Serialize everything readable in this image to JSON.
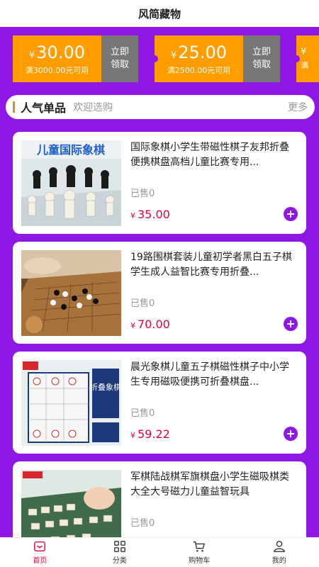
{
  "header": {
    "title": "风简藏物"
  },
  "coupons": [
    {
      "currency": "¥",
      "amount": "30.00",
      "condition": "满3000.00元可用",
      "action_line1": "立即",
      "action_line2": "领取"
    },
    {
      "currency": "¥",
      "amount": "25.00",
      "condition": "满2500.00元可用",
      "action_line1": "立即",
      "action_line2": "领取"
    },
    {
      "currency": "¥",
      "amount": "",
      "condition": "满",
      "action_line1": "",
      "action_line2": ""
    }
  ],
  "section": {
    "title": "人气单品",
    "subtitle": "欢迎选购",
    "more": "更多"
  },
  "products": [
    {
      "name": "国际象棋小学生带磁性棋子友邦折叠便携棋盘高档儿童比赛专用...",
      "sold": "已售0",
      "currency": "¥",
      "price": "35.00",
      "image_text": "儿童国际象棋"
    },
    {
      "name": "19路围棋套装儿童初学者黑白五子棋学生成人益智比赛专用折叠...",
      "sold": "已售0",
      "currency": "¥",
      "price": "70.00"
    },
    {
      "name": "晨光象棋儿童五子棋磁性棋子中小学生专用磁吸便携可折叠棋盘...",
      "sold": "已售0",
      "currency": "¥",
      "price": "59.22",
      "image_text": "折叠象棋"
    },
    {
      "name": "军棋陆战棋军旗棋盘小学生磁吸棋类大全大号磁力儿童益智玩具",
      "sold": "已售0",
      "currency": "¥",
      "price": ""
    }
  ],
  "tabs": [
    {
      "label": "首页",
      "icon": "home-icon"
    },
    {
      "label": "分类",
      "icon": "grid-icon"
    },
    {
      "label": "购物车",
      "icon": "cart-icon"
    },
    {
      "label": "我的",
      "icon": "user-icon"
    }
  ],
  "colors": {
    "brand": "#8e17e6",
    "coupon": "#ff9c00",
    "price": "#e5003a"
  }
}
